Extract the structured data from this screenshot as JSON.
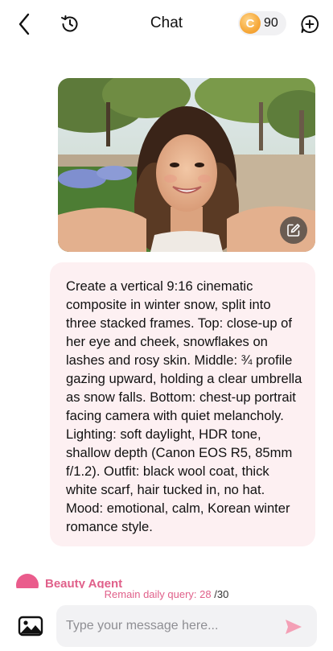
{
  "header": {
    "title": "Chat",
    "coin_count": "90",
    "coin_letter": "C"
  },
  "icons": {
    "back": "chevron-left-icon",
    "history": "history-clock-icon",
    "coin": "coin-icon",
    "new_chat": "plus-circle-icon",
    "edit": "edit-icon",
    "image_upload": "image-icon",
    "send": "send-icon"
  },
  "messages": {
    "photo": {
      "description_icon": "photo-message"
    },
    "prompt_text": "Create a vertical 9:16 cinematic composite in winter snow, split into three stacked frames. Top: close-up of her eye and cheek, snowflakes on lashes and rosy skin. Middle: ¾ profile gazing upward, holding a clear umbrella as snow falls. Bottom: chest-up portrait facing camera with quiet melancholy. Lighting: soft daylight, HDR tone, shallow depth (Canon EOS R5, 85mm f/1.2). Outfit: black wool coat, thick white scarf, hair tucked in, no hat. Mood: emotional, calm, Korean winter romance style."
  },
  "agent": {
    "name": "Beauty Agent"
  },
  "quota": {
    "label": "Remain daily query:",
    "remaining": "28",
    "total": "/30"
  },
  "composer": {
    "placeholder": "Type your message here..."
  },
  "colors": {
    "accent_pink": "#e0608a",
    "bubble_bg": "#fdf0f2",
    "coin_orange": "#f6a93b",
    "input_bg": "#f2f2f4"
  }
}
